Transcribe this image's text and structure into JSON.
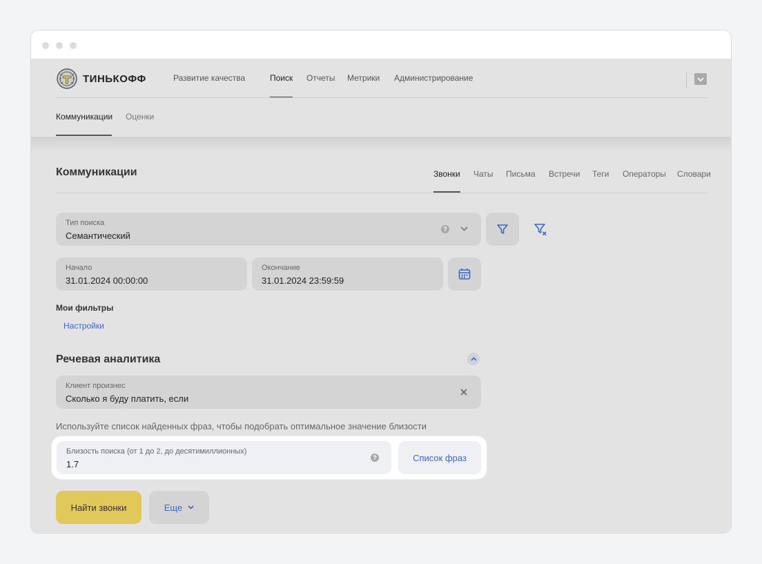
{
  "brand": {
    "name": "ТИНЬКОФФ"
  },
  "topnav": {
    "items": [
      {
        "label": "Развитие качества"
      },
      {
        "label": "Поиск"
      },
      {
        "label": "Отчеты"
      },
      {
        "label": "Метрики"
      },
      {
        "label": "Администрирование"
      }
    ],
    "active": "Поиск"
  },
  "subnav": {
    "items": [
      {
        "label": "Коммуникации"
      },
      {
        "label": "Оценки"
      }
    ],
    "active": "Коммуникации"
  },
  "page": {
    "title": "Коммуникации",
    "tabs": [
      {
        "label": "Звонки"
      },
      {
        "label": "Чаты"
      },
      {
        "label": "Письма"
      },
      {
        "label": "Встречи"
      },
      {
        "label": "Теги"
      },
      {
        "label": "Операторы"
      },
      {
        "label": "Словари"
      }
    ],
    "active_tab": "Звонки"
  },
  "search_type": {
    "label": "Тип поиска",
    "value": "Семантический"
  },
  "date_start": {
    "label": "Начало",
    "value": "31.01.2024 00:00:00"
  },
  "date_end": {
    "label": "Окончание",
    "value": "31.01.2024 23:59:59"
  },
  "my_filters": {
    "label": "Мои фильтры",
    "settings_link": "Настройки"
  },
  "speech_analytics": {
    "title": "Речевая аналитика",
    "client_said": {
      "label": "Клиент произнес",
      "value": "Сколько я буду платить, если"
    },
    "hint": "Используйте список найденных фраз, чтобы подобрать оптимальное значение близости",
    "proximity": {
      "label": "Близость поиска (от 1 до 2, до десятимиллионных)",
      "value": "1.7"
    },
    "phrases_button": "Список фраз"
  },
  "actions": {
    "find_calls": "Найти звонки",
    "more": "Еще"
  },
  "colors": {
    "accent": "#3b66c4",
    "primary": "#e0c95a",
    "background": "#e3e3e3"
  }
}
